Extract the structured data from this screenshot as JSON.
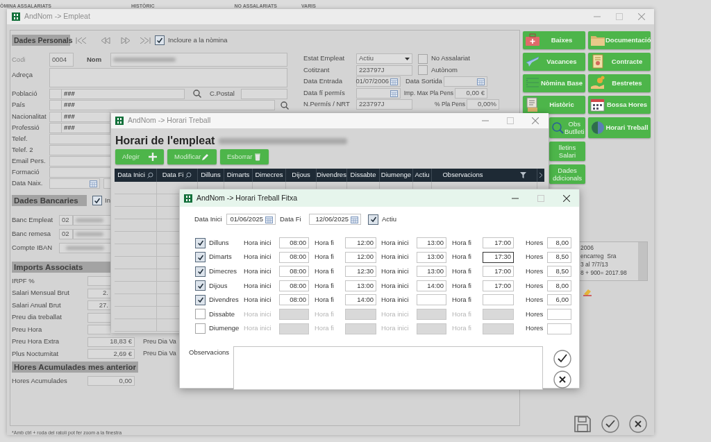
{
  "background_tabs": [
    {
      "label": "ÒMINA ASSALARIATS"
    },
    {
      "label": "HISTÒRIC"
    },
    {
      "label": "NO ASSALARIATS"
    },
    {
      "label": "VARIS"
    }
  ],
  "employee": {
    "title": "AndNom -> Empleat",
    "personal_heading": "Dades Personals",
    "include": {
      "label": "Incloure a la nòmina",
      "checked": true
    },
    "code": {
      "label": "Codi",
      "value": "0004"
    },
    "name_label": "Nom",
    "address_label": "Adreça",
    "lookup_rows": [
      {
        "label": "Població",
        "value": "###"
      },
      {
        "label": "País",
        "value": "###"
      },
      {
        "label": "Nacionalitat",
        "value": "###"
      },
      {
        "label": "Professió",
        "value": "###"
      }
    ],
    "postal_label": "C.Postal",
    "contact_rows": [
      {
        "label": "Telef.",
        "kind": "text"
      },
      {
        "label": "Telef. 2",
        "kind": "text"
      },
      {
        "label": "Email Pers.",
        "kind": "text"
      },
      {
        "label": "Formació",
        "kind": "text"
      },
      {
        "label": "Data Naix.",
        "kind": "date"
      }
    ],
    "bank_heading": "Dades Bancaries",
    "bank_check": {
      "label": "In",
      "checked": true
    },
    "bank_rows": [
      {
        "label": "Banc Empleat",
        "code": "02"
      },
      {
        "label": "Banc remesa",
        "code": "02"
      },
      {
        "label": "Compte IBAN"
      }
    ],
    "imports_heading": "Imports Associats",
    "imports": [
      {
        "label": "IRPF %"
      },
      {
        "label": "Salari Mensual Brut",
        "value": "2."
      },
      {
        "label": "Salari Anual Brut",
        "value": "27."
      },
      {
        "label": "Preu dia treballat"
      },
      {
        "label": "Preu Hora"
      },
      {
        "label": "Preu Hora Extra",
        "value": "18,83 €",
        "side_label": "Preu Dia Va"
      },
      {
        "label": "Plus Nocturnitat",
        "value": "2,69 €",
        "side_label": "Preu Dia Va"
      }
    ],
    "accum_heading": "Hores Acumulades mes anterior",
    "accum": {
      "label": "Hores Acumulades",
      "value": "0,00"
    },
    "employment": [
      {
        "label": "Estat Empleat",
        "kind": "select",
        "value": "Actiu",
        "side": {
          "kind": "checkbox",
          "label": "No Assalariat",
          "checked": false
        }
      },
      {
        "label": "Cotitzant",
        "kind": "text",
        "value": "223797J",
        "side": {
          "kind": "checkbox",
          "label": "Autònom",
          "checked": false
        }
      },
      {
        "label": "Data Entrada",
        "kind": "date",
        "value": "01/07/2006",
        "side": {
          "kind": "date",
          "label": "Data Sortida"
        }
      },
      {
        "label": "Data fí permís",
        "kind": "date",
        "side": {
          "kind": "amount",
          "label": "Imp. Max Pla Pens",
          "value": "0,00 €"
        }
      },
      {
        "label": "N.Permís / NRT",
        "kind": "text",
        "value": "223797J",
        "side": {
          "kind": "amount",
          "label": "% Pla Pens",
          "value": "0,00%"
        }
      }
    ],
    "buttons_left": [
      {
        "label": "Baixes"
      },
      {
        "label": "Vacances"
      },
      {
        "label": "Nòmina Base"
      },
      {
        "label": "Històric"
      },
      {
        "label": "Obs Butlleti"
      },
      {
        "label": "lletins Salari"
      },
      {
        "label": "Dades ddicionals"
      }
    ],
    "buttons_right": [
      {
        "label": "Documentació"
      },
      {
        "label": "Contracte"
      },
      {
        "label": "Bestretes"
      },
      {
        "label": "Bossa Hores"
      },
      {
        "label": "Horari Treball"
      }
    ],
    "notes": [
      "2006",
      "encarreg  Sra",
      "3 al 7/7/13",
      "8 + 900= 2017.98"
    ],
    "footer": "*Amb ctrl + roda del ratolí pot fer zoom a la finestra"
  },
  "schedule_window": {
    "title": "AndNom -> Horari Treball",
    "heading": "Horari de l'empleat",
    "buttons": [
      {
        "label": "Afegir",
        "kind": "add"
      },
      {
        "label": "Modificar",
        "kind": "edit"
      },
      {
        "label": "Esborrar",
        "kind": "delete"
      }
    ],
    "columns": [
      {
        "label": "Data Inici",
        "kind": "date"
      },
      {
        "label": "Data Fi",
        "kind": "date"
      },
      {
        "label": "Dilluns",
        "kind": "day"
      },
      {
        "label": "Dimarts",
        "kind": "day"
      },
      {
        "label": "Dimecres",
        "kind": "day"
      },
      {
        "label": "Dijous",
        "kind": "day"
      },
      {
        "label": "Divendres",
        "kind": "day"
      },
      {
        "label": "Dissabte",
        "kind": "day"
      },
      {
        "label": "Diumenge",
        "kind": "day"
      },
      {
        "label": "Actiu",
        "kind": "day"
      },
      {
        "label": "Observacions",
        "kind": "text"
      }
    ]
  },
  "dialog": {
    "title": "AndNom -> Horari Treball Fitxa",
    "start": {
      "label": "Data Inici",
      "value": "01/06/2025"
    },
    "end": {
      "label": "Data Fi",
      "value": "12/06/2025"
    },
    "active": {
      "label": "Actiu",
      "checked": true
    },
    "days": [
      {
        "label": "Dilluns",
        "checked": true,
        "times": [
          {
            "label": "Hora inici",
            "value": "08:00",
            "focused": false
          },
          {
            "label": "Hora fi",
            "value": "12:00",
            "focused": false
          },
          {
            "label": "Hora inici",
            "value": "13:00",
            "focused": false
          },
          {
            "label": "Hora fi",
            "value": "17:00",
            "focused": false
          }
        ],
        "hours_label": "Hores",
        "hours": "8,00"
      },
      {
        "label": "Dimarts",
        "checked": true,
        "times": [
          {
            "label": "Hora inici",
            "value": "08:00",
            "focused": false
          },
          {
            "label": "Hora fi",
            "value": "12:00",
            "focused": false
          },
          {
            "label": "Hora inici",
            "value": "13:00",
            "focused": false
          },
          {
            "label": "Hora fi",
            "value": "17:30",
            "focused": true
          }
        ],
        "hours_label": "Hores",
        "hours": "8,50"
      },
      {
        "label": "Dimecres",
        "checked": true,
        "times": [
          {
            "label": "Hora inici",
            "value": "08:00",
            "focused": false
          },
          {
            "label": "Hora fi",
            "value": "12:30",
            "focused": false
          },
          {
            "label": "Hora inici",
            "value": "13:00",
            "focused": false
          },
          {
            "label": "Hora fi",
            "value": "17:00",
            "focused": false
          }
        ],
        "hours_label": "Hores",
        "hours": "8,50"
      },
      {
        "label": "Dijous",
        "checked": true,
        "times": [
          {
            "label": "Hora inici",
            "value": "08:00",
            "focused": false
          },
          {
            "label": "Hora fi",
            "value": "13:00",
            "focused": false
          },
          {
            "label": "Hora inici",
            "value": "14:00",
            "focused": false
          },
          {
            "label": "Hora fi",
            "value": "17:00",
            "focused": false
          }
        ],
        "hours_label": "Hores",
        "hours": "8,00"
      },
      {
        "label": "Divendres",
        "checked": true,
        "times": [
          {
            "label": "Hora inici",
            "value": "08:00",
            "focused": false
          },
          {
            "label": "Hora fi",
            "value": "14:00",
            "focused": false
          },
          {
            "label": "Hora inici",
            "focused": false
          },
          {
            "label": "Hora fi",
            "focused": false
          }
        ],
        "hours_label": "Hores",
        "hours": "6,00"
      },
      {
        "label": "Dissabte",
        "checked": false,
        "times": [
          {
            "label": "Hora inici",
            "focused": false
          },
          {
            "label": "Hora fi",
            "focused": false
          },
          {
            "label": "Hora inici",
            "focused": false
          },
          {
            "label": "Hora fi",
            "focused": false
          }
        ],
        "hours_label": "Hores"
      },
      {
        "label": "Diumenge",
        "checked": false,
        "times": [
          {
            "label": "Hora inici",
            "focused": false
          },
          {
            "label": "Hora fi",
            "focused": false
          },
          {
            "label": "Hora inici",
            "focused": false
          },
          {
            "label": "Hora fi",
            "focused": false
          }
        ],
        "hours_label": "Hores"
      }
    ],
    "notes_label": "Observacions"
  }
}
